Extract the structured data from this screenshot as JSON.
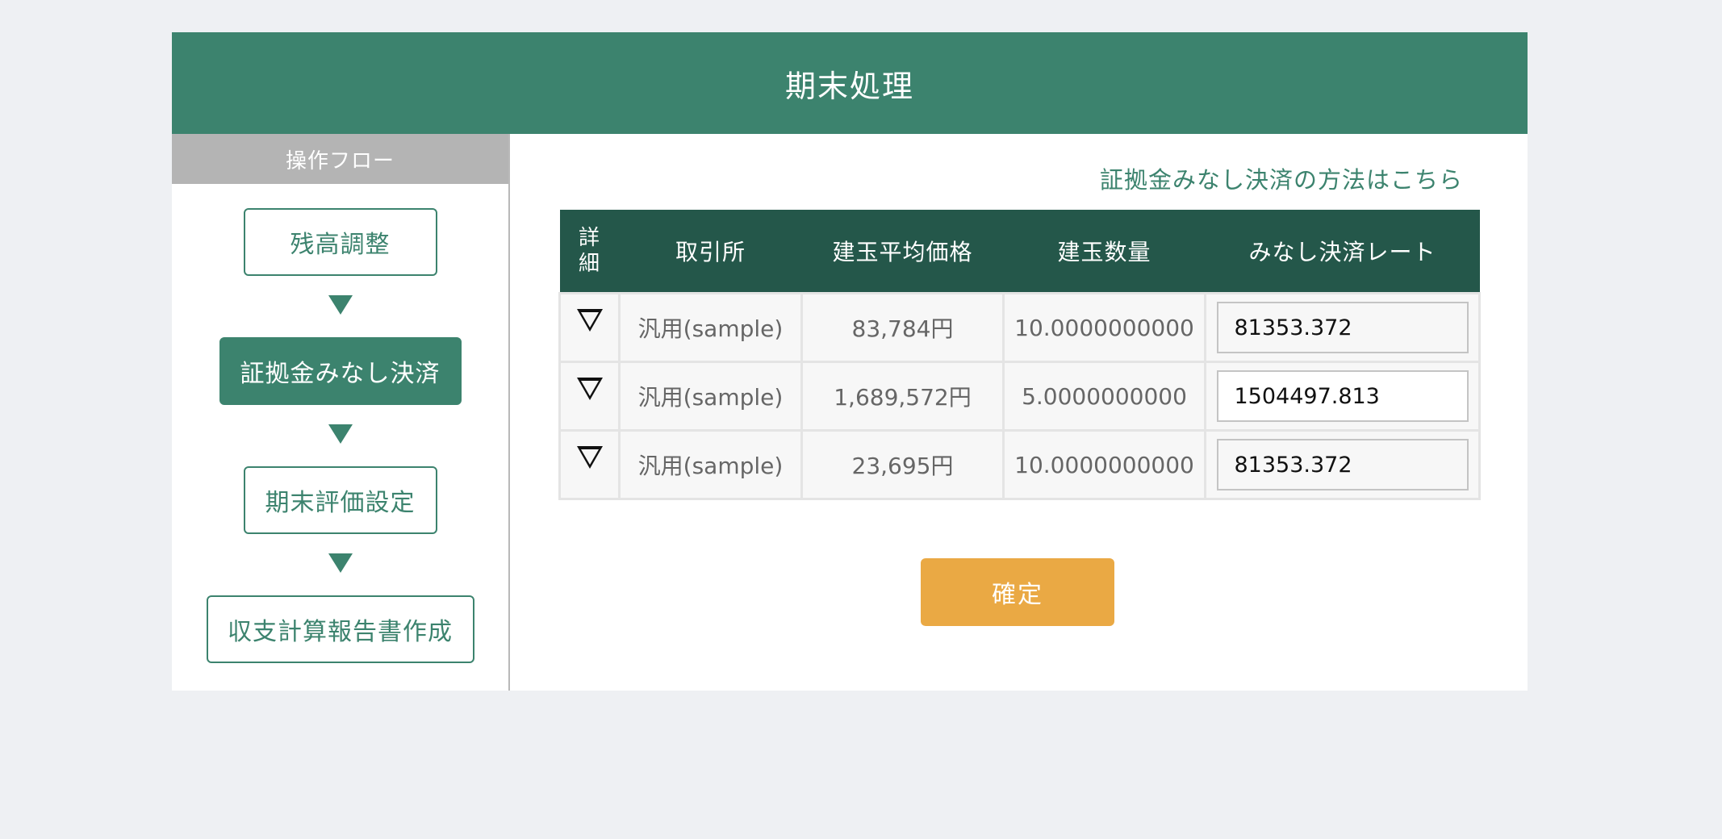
{
  "page": {
    "title": "期末処理"
  },
  "sidebar": {
    "header": "操作フロー",
    "steps": [
      {
        "label": "残高調整",
        "active": false
      },
      {
        "label": "証拠金みなし決済",
        "active": true
      },
      {
        "label": "期末評価設定",
        "active": false
      },
      {
        "label": "収支計算報告書作成",
        "active": false
      }
    ]
  },
  "main": {
    "help_link": "証拠金みなし決済の方法はこちら",
    "table": {
      "headers": [
        "詳細",
        "取引所",
        "建玉平均価格",
        "建玉数量",
        "みなし決済レート"
      ],
      "detail_header_lines": [
        "詳",
        "細"
      ],
      "rows": [
        {
          "exchange": "汎用(sample)",
          "avg_price": "83,784円",
          "quantity": "10.0000000000",
          "rate": "81353.372"
        },
        {
          "exchange": "汎用(sample)",
          "avg_price": "1,689,572円",
          "quantity": "5.0000000000",
          "rate": "1504497.813"
        },
        {
          "exchange": "汎用(sample)",
          "avg_price": "23,695円",
          "quantity": "10.0000000000",
          "rate": "81353.372"
        }
      ]
    },
    "confirm_label": "確定"
  },
  "colors": {
    "primary": "#3c836e",
    "table_header": "#24574a",
    "accent_button": "#eaa944",
    "sidebar_header": "#b4b4b4",
    "background": "#eef0f3"
  },
  "icons": {
    "step_arrow": "triangle-down",
    "row_toggle": "nabla-outline"
  }
}
